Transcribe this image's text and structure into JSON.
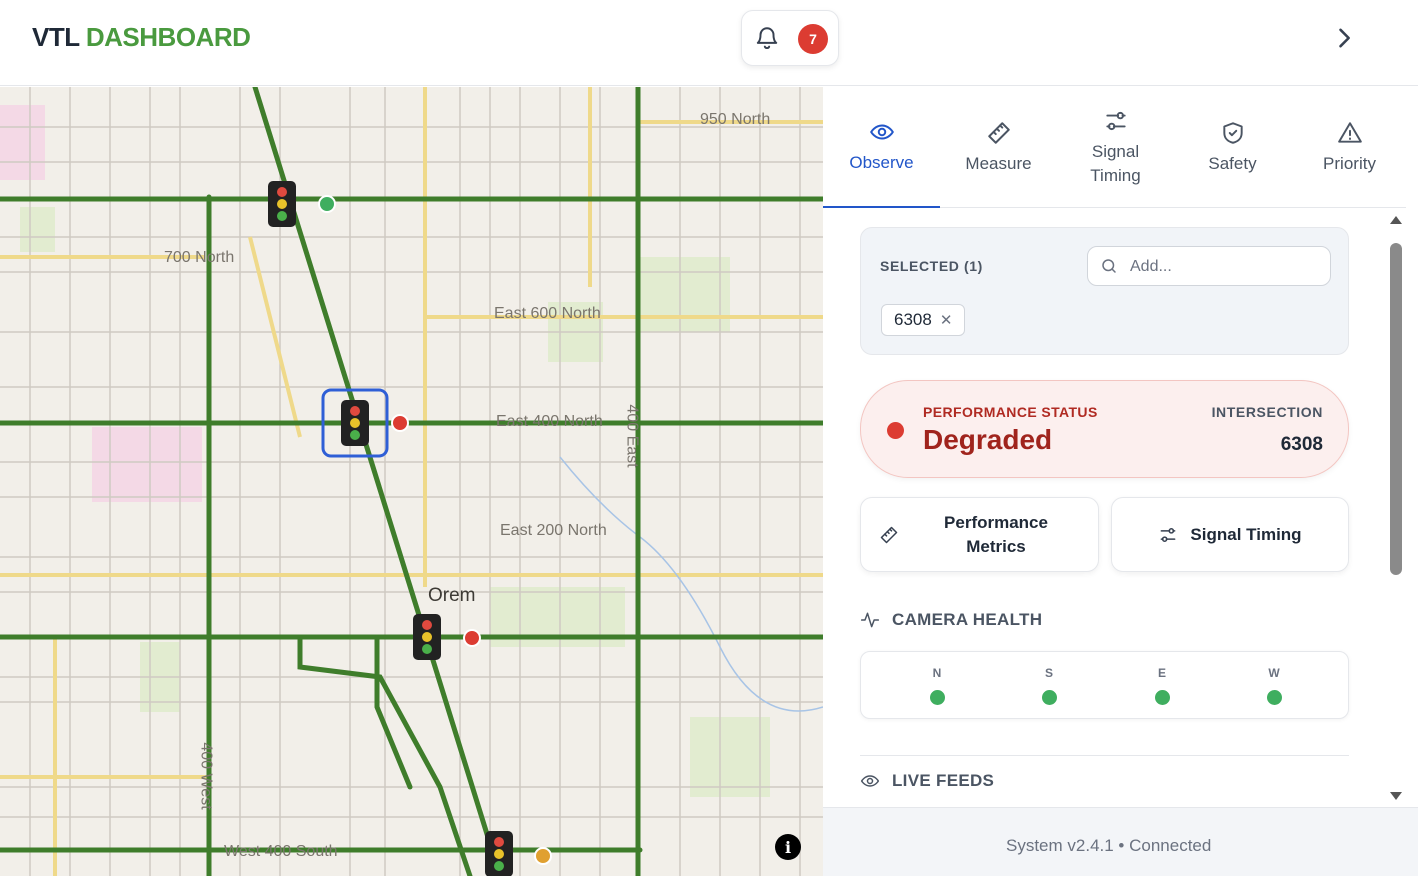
{
  "header": {
    "brand_part1": "VTL",
    "brand_part2": "DASHBOARD",
    "notification_count": "7"
  },
  "map": {
    "labels": {
      "n950": "950 North",
      "n700": "700 North",
      "e600": "East 600 North",
      "e400": "East 400 North",
      "e200": "East 200 North",
      "city": "Orem",
      "w400s": "West 400 South",
      "e400v": "400 East",
      "w400v": "400 West"
    },
    "signal_status_colors": {
      "healthy": "#3fae5f",
      "degraded": "#dc3c32",
      "warning": "#e0a030"
    }
  },
  "tabs": [
    {
      "label": "Observe",
      "icon": "eye-icon"
    },
    {
      "label": "Measure",
      "icon": "ruler-icon"
    },
    {
      "label": "Signal\nTiming",
      "icon": "sliders-icon"
    },
    {
      "label": "Safety",
      "icon": "shield-check-icon"
    },
    {
      "label": "Priority",
      "icon": "warning-triangle-icon"
    }
  ],
  "selected": {
    "title": "SELECTED (1)",
    "add_placeholder": "Add...",
    "chips": [
      "6308"
    ]
  },
  "status": {
    "label": "PERFORMANCE STATUS",
    "value": "Degraded",
    "intersection_label": "INTERSECTION",
    "intersection_value": "6308",
    "color": "#dc3c32"
  },
  "actions": {
    "performance_metrics": "Performance Metrics",
    "signal_timing": "Signal Timing"
  },
  "camera_health": {
    "title": "CAMERA HEALTH",
    "cameras": [
      {
        "dir": "N",
        "status": "healthy"
      },
      {
        "dir": "S",
        "status": "healthy"
      },
      {
        "dir": "E",
        "status": "healthy"
      },
      {
        "dir": "W",
        "status": "healthy"
      }
    ]
  },
  "live_feeds": {
    "title": "LIVE FEEDS"
  },
  "footer": {
    "text": "System v2.4.1 • Connected"
  }
}
